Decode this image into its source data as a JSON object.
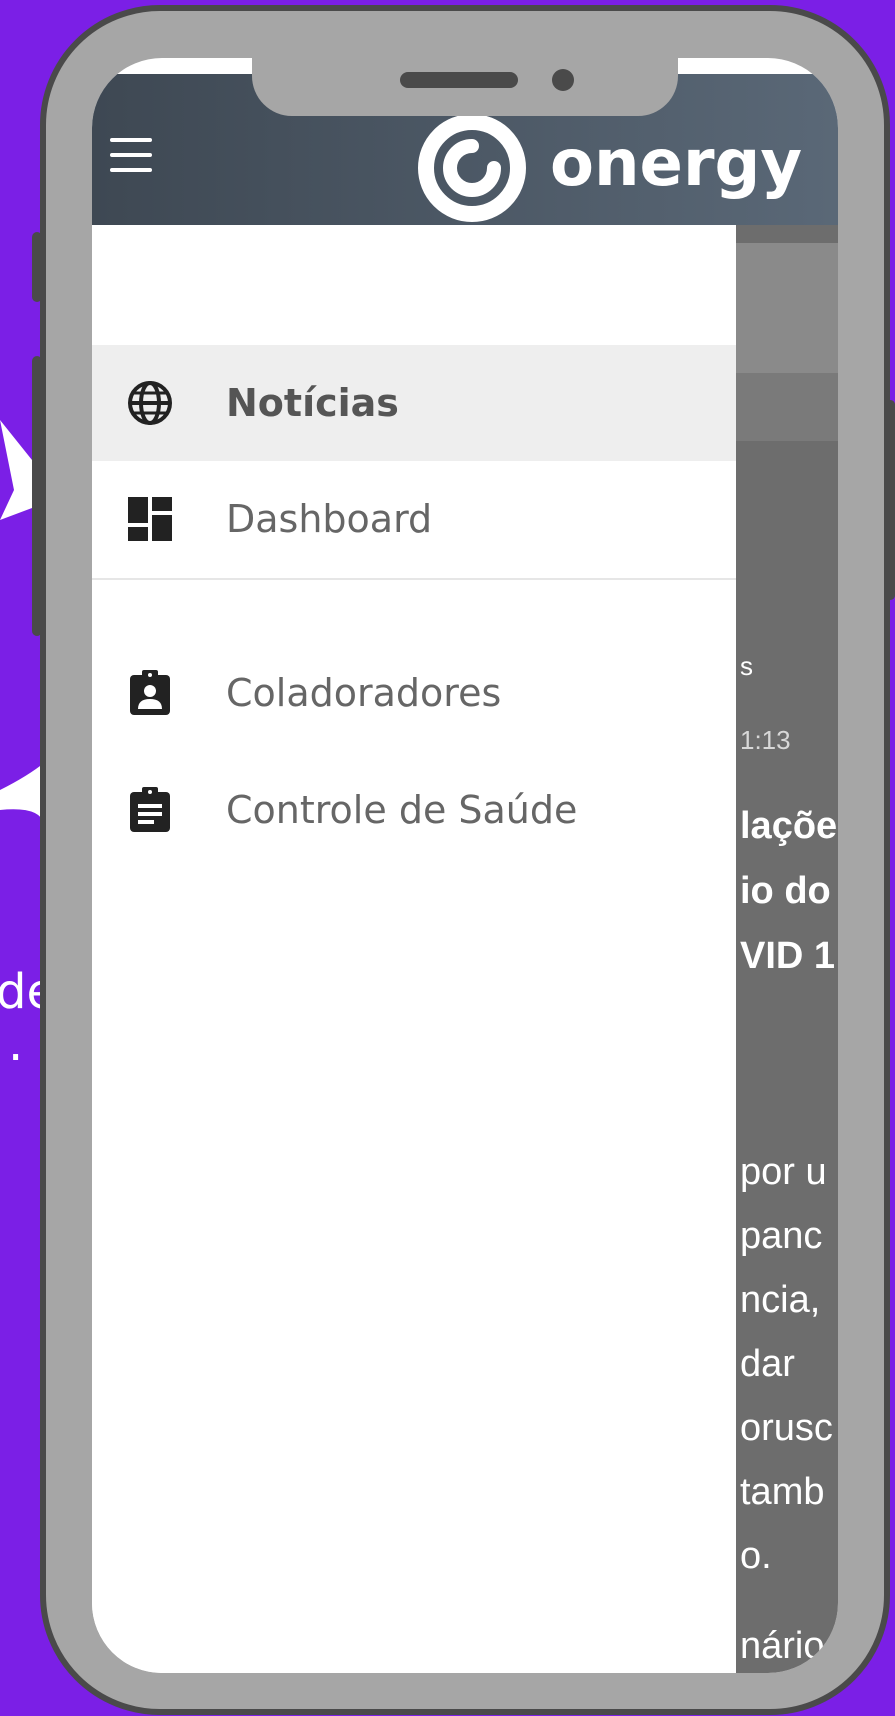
{
  "app": {
    "brand": "onergy"
  },
  "drawer": {
    "items": [
      {
        "label": "Notícias",
        "icon": "globe-icon",
        "active": true
      },
      {
        "label": "Dashboard",
        "icon": "dashboard-icon",
        "active": false
      },
      {
        "label": "Coladoradores",
        "icon": "badge-icon",
        "active": false
      },
      {
        "label": "Controle de Saúde",
        "icon": "clipboard-icon",
        "active": false
      }
    ]
  },
  "content_peek": {
    "lines": [
      "s",
      "1:13",
      "laçõe",
      "io do",
      "VID 1",
      "por u",
      "panc",
      "ncia,",
      "dar",
      "orusc",
      "tamb",
      "o.",
      "nário",
      "..."
    ]
  },
  "background": {
    "left_text": [
      "de",
      "."
    ]
  },
  "colors": {
    "background": "#7b1fe6",
    "phone_frame": "#a6a6a6",
    "header_start": "#3e4853",
    "header_end": "#5a6877",
    "drawer_active": "#eeeeee",
    "label_text": "#666666"
  }
}
